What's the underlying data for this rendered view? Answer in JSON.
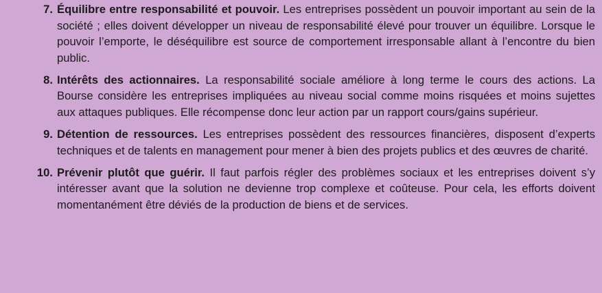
{
  "items": [
    {
      "number": "7.",
      "title": "Équilibre entre responsabilité et pouvoir.",
      "text": " Les entreprises possèdent un pouvoir important au sein de la société ; elles doivent développer un niveau de responsabilité élevé pour trouver un équilibre. Lorsque le pouvoir l’emporte, le déséquilibre est source de comportement irresponsable allant à l’encontre du bien public."
    },
    {
      "number": "8.",
      "title": "Intérêts des actionnaires.",
      "text": " La responsabilité sociale améliore à long terme le cours des actions. La Bourse considère les entreprises impliquées au niveau social comme moins risquées et moins sujettes aux attaques publiques. Elle récompense donc leur action par un rapport cours/gains supérieur."
    },
    {
      "number": "9.",
      "title": "Détention de ressources.",
      "text": " Les entreprises possèdent des ressources financières, disposent d’experts techniques et de talents en management pour mener à bien des projets publics et des œuvres de charité."
    },
    {
      "number": "10.",
      "title": "Prévenir plutôt que guérir.",
      "text": " Il faut parfois régler des problèmes sociaux et les entreprises doivent s’y intéresser avant que la solution ne devienne trop complexe et coûteuse. Pour cela, les efforts doivent momentanément être déviés de la production de biens et de services."
    }
  ]
}
